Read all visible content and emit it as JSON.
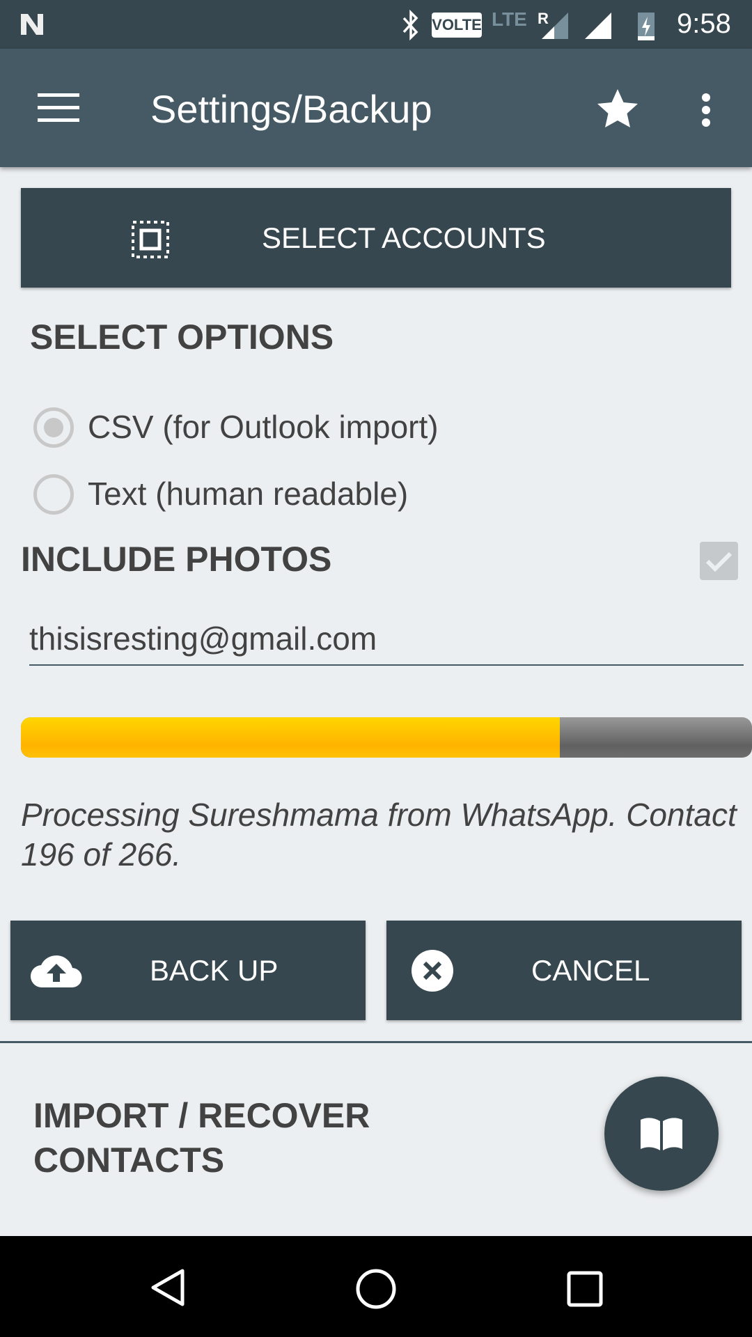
{
  "status_bar": {
    "time": "9:58",
    "volte": "VOLTE",
    "lte": "LTE",
    "roaming": "R"
  },
  "app_bar": {
    "title": "Settings/Backup"
  },
  "select_accounts": {
    "label": "SELECT ACCOUNTS"
  },
  "options": {
    "heading": "SELECT OPTIONS",
    "formats": [
      {
        "label": "CSV (for Outlook import)",
        "selected": true
      },
      {
        "label": "Text (human readable)",
        "selected": false
      }
    ]
  },
  "include_photos": {
    "label": "INCLUDE PHOTOS",
    "checked": true
  },
  "email": {
    "value": "thisisresting@gmail.com"
  },
  "progress": {
    "current": 196,
    "total": 266,
    "fraction": 0.737,
    "fill_color": "#ffc107",
    "track_color": "#6d6d6d"
  },
  "status_message": "Processing Sureshmama from WhatsApp. Contact 196 of 266.",
  "actions": {
    "backup": "BACK UP",
    "cancel": "CANCEL"
  },
  "import": {
    "heading_line1": "IMPORT / RECOVER",
    "heading_line2": "CONTACTS"
  },
  "colors": {
    "primary": "#455a64",
    "dark": "#37474f",
    "background": "#eceff1"
  }
}
